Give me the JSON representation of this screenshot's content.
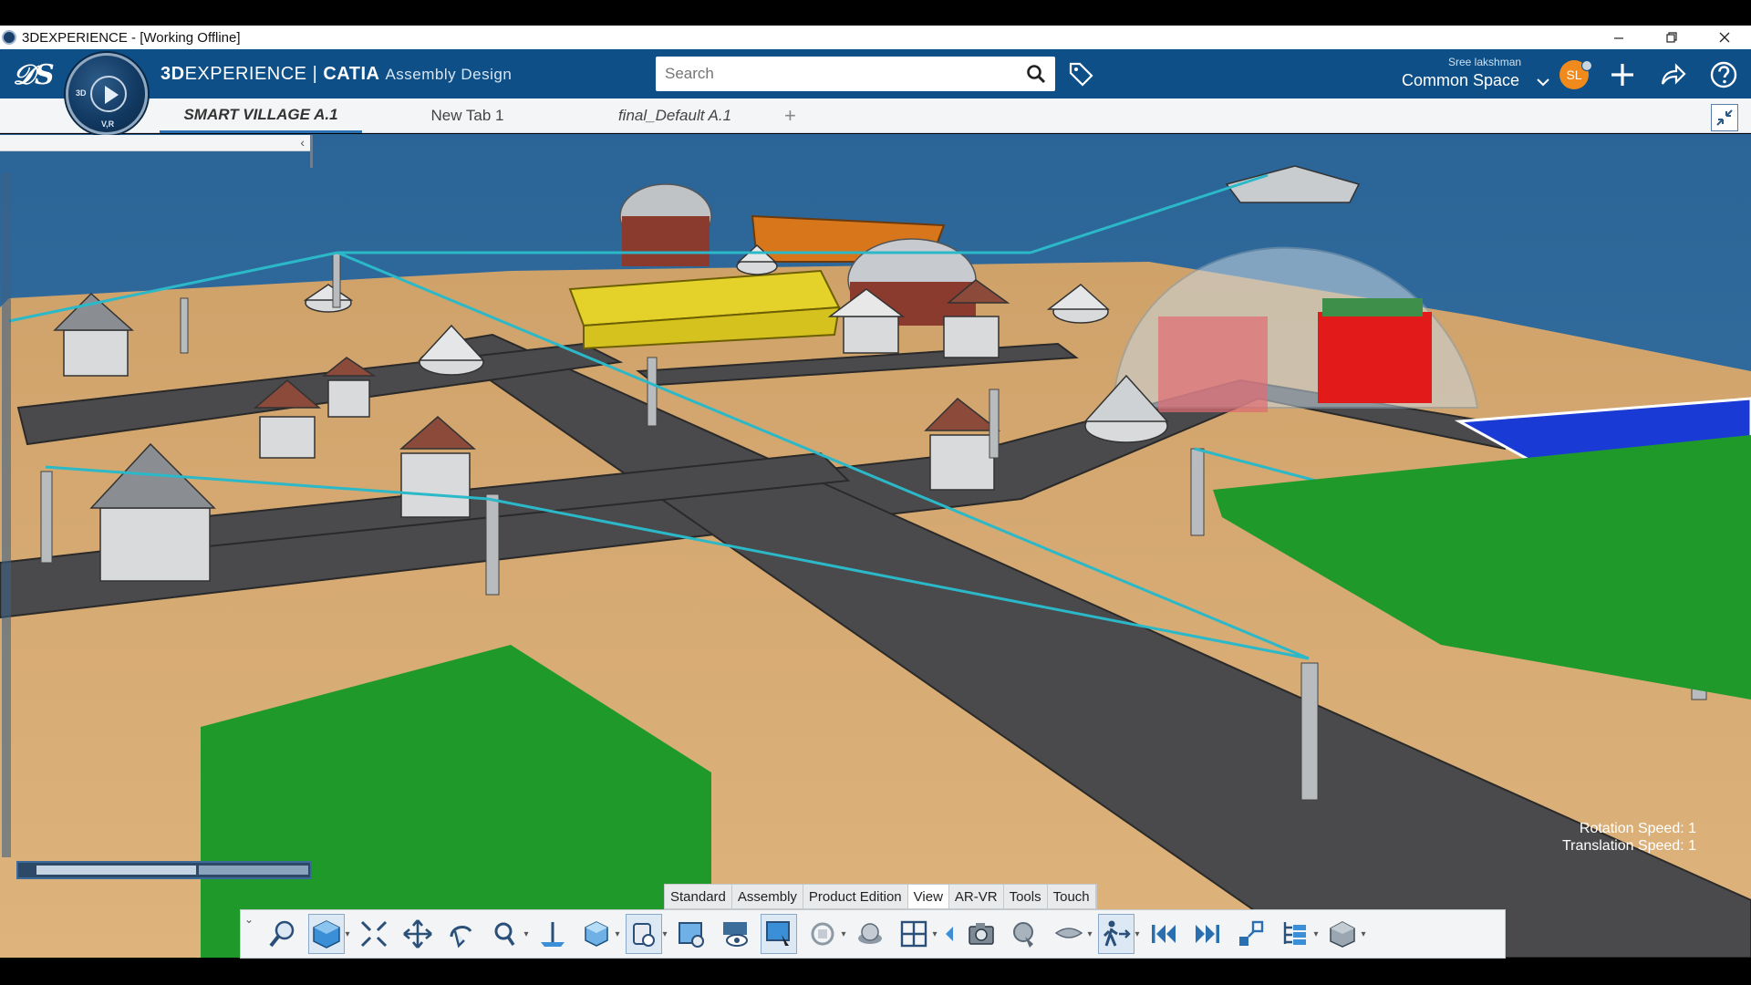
{
  "window": {
    "title": "3DEXPERIENCE - [Working Offline]",
    "minimize_icon": "minimize-icon",
    "restore_icon": "restore-icon",
    "close_icon": "close-icon"
  },
  "header": {
    "brand_3d": "3D",
    "brand_experience": "EXPERIENCE",
    "brand_separator": " | ",
    "brand_catia": "CATIA",
    "app_name": "Assembly Design",
    "search_placeholder": "Search",
    "user_name": "Sree lakshman",
    "space": "Common Space",
    "avatar_initials": "SL"
  },
  "compass": {
    "label_top": "3D",
    "label_bottom": "V,R"
  },
  "tabs": [
    {
      "label": "SMART VILLAGE A.1",
      "active": true
    },
    {
      "label": "New Tab 1",
      "active": false
    },
    {
      "label": "final_Default A.1",
      "active": false
    }
  ],
  "viewport": {
    "rotation_speed": "Rotation Speed: 1",
    "translation_speed": "Translation Speed: 1"
  },
  "sections": [
    {
      "label": "Standard",
      "active": false
    },
    {
      "label": "Assembly",
      "active": false
    },
    {
      "label": "Product Edition",
      "active": false
    },
    {
      "label": "View",
      "active": true
    },
    {
      "label": "AR-VR",
      "active": false
    },
    {
      "label": "Tools",
      "active": false
    },
    {
      "label": "Touch",
      "active": false
    }
  ],
  "tools": [
    "zoom-area-icon",
    "view-cube-icon",
    "fit-all-icon",
    "pan-icon",
    "rotate-icon",
    "zoom-icon",
    "normal-view-icon",
    "iso-view-icon",
    "render-style-icon",
    "view-mode-icon",
    "hide-show-icon",
    "swap-visible-icon",
    "ambient-occlusion-icon",
    "shading-icon",
    "multi-view-icon",
    "previous-icon",
    "capture-icon",
    "look-at-icon",
    "fly-icon",
    "walk-icon",
    "first-frame-icon",
    "last-frame-icon",
    "explode-icon",
    "tree-reorder-icon",
    "component-icon"
  ],
  "colors": {
    "header_bg": "#0d4f86",
    "sky": "#2f6a99",
    "ground": "#d8ad74",
    "road": "#4d4d4f",
    "cable": "#2bb8c8",
    "crops": "#1f9a2a",
    "avatar": "#f08a1c"
  }
}
